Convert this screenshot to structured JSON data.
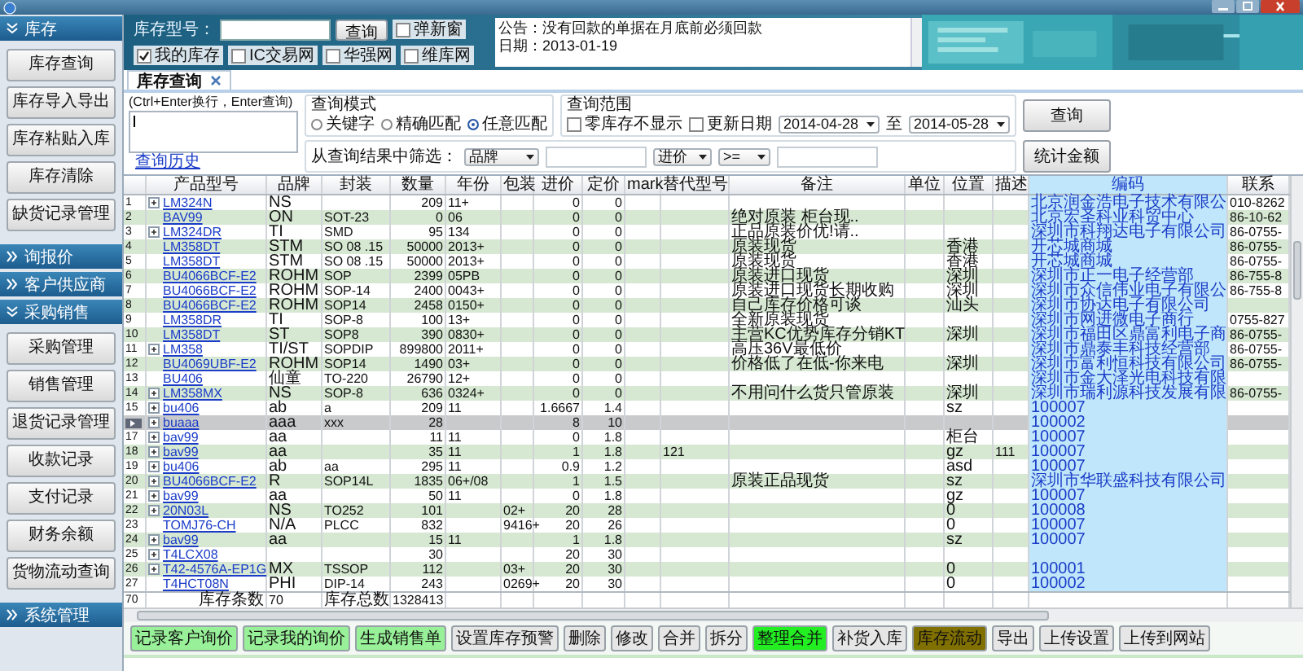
{
  "sidebar": {
    "sections": [
      {
        "title": "库存",
        "expanded": true,
        "items": [
          "库存查询",
          "库存导入导出",
          "库存粘贴入库",
          "库存清除",
          "缺货记录管理"
        ]
      },
      {
        "title": "询报价",
        "expanded": false
      },
      {
        "title": "客户供应商",
        "expanded": false
      },
      {
        "title": "采购销售",
        "expanded": true,
        "items": [
          "采购管理",
          "销售管理",
          "退货记录管理",
          "收款记录",
          "支付记录",
          "财务余额",
          "货物流动查询"
        ]
      },
      {
        "title": "系统管理",
        "expanded": false
      }
    ]
  },
  "toolbar": {
    "model_label": "库存型号：",
    "search_button": "查询",
    "new_window": {
      "label": "弹新窗",
      "checked": false
    },
    "sources": [
      {
        "label": "我的库存",
        "checked": true
      },
      {
        "label": "IC交易网",
        "checked": false
      },
      {
        "label": "华强网",
        "checked": false
      },
      {
        "label": "维库网",
        "checked": false
      }
    ]
  },
  "notice": {
    "lines": [
      "公告：没有回款的单据在月底前必须回款",
      "日期：2013-01-19"
    ]
  },
  "tabs": [
    {
      "label": "库存查询",
      "selected": true
    }
  ],
  "query": {
    "hint": "(Ctrl+Enter换行，Enter查询)",
    "history_link": "查询历史",
    "mode": {
      "title": "查询模式",
      "options": [
        {
          "label": "关键字",
          "selected": false
        },
        {
          "label": "精确匹配",
          "selected": false
        },
        {
          "label": "任意匹配",
          "selected": true
        }
      ]
    },
    "range": {
      "title": "查询范围",
      "zero_stock": {
        "label": "零库存不显示",
        "checked": false
      },
      "update_date": {
        "label": "更新日期",
        "checked": false
      },
      "from": "2014-04-28",
      "to_label": "至",
      "to": "2014-05-28"
    },
    "search_button": "查询",
    "filter": {
      "label": "从查询结果中筛选：",
      "field": "品牌",
      "price_field": "进价",
      "operator": ">="
    },
    "sum_button": "统计金额"
  },
  "table": {
    "columns": [
      "产品型号",
      "品牌",
      "封装",
      "数量",
      "年份",
      "包装",
      "进价",
      "定价",
      "mark",
      "替代型号",
      "备注",
      "单位",
      "位置",
      "描述",
      "编码",
      "联系"
    ],
    "rows": [
      {
        "no": "1",
        "expandable": true,
        "selected": false,
        "model": "LM324N",
        "brand": "NS",
        "qty": "209",
        "year": "11+",
        "cost": "0",
        "price": "0",
        "code": "北京润金浩电子技术有限公",
        "contact": "010-8262"
      },
      {
        "no": "2",
        "expandable": false,
        "selected": false,
        "model": "BAV99",
        "brand": "ON",
        "package": "SOT-23",
        "qty": "0",
        "year": "06",
        "cost": "0",
        "price": "0",
        "note": "绝对原装 柜台现..",
        "code": "北京宏圣科业科贸中心",
        "contact": "86-10-62"
      },
      {
        "no": "3",
        "expandable": true,
        "selected": false,
        "model": "LM324DR",
        "brand": "TI",
        "package": "SMD",
        "qty": "95",
        "year": "134",
        "cost": "0",
        "price": "0",
        "note": "正品原装价优!请..",
        "code": "深圳市科翔达电子有限公司",
        "contact": "86-0755-"
      },
      {
        "no": "4",
        "expandable": false,
        "selected": false,
        "model": "LM358DT",
        "brand": "STM",
        "package": "SO 08 .15",
        "qty": "50000",
        "year": "2013+",
        "cost": "0",
        "price": "0",
        "note": "原装现货",
        "location": "香港",
        "code": "开芯城商城",
        "contact": "86-0755-"
      },
      {
        "no": "5",
        "expandable": false,
        "selected": false,
        "model": "LM358DT",
        "brand": "STM",
        "package": "SO 08 .15",
        "qty": "50000",
        "year": "2013+",
        "cost": "0",
        "price": "0",
        "note": "原装现货",
        "location": "香港",
        "code": "开芯城商城",
        "contact": "86-0755-"
      },
      {
        "no": "6",
        "expandable": false,
        "selected": false,
        "model": "BU4066BCF-E2",
        "brand": "ROHM",
        "package": "SOP",
        "qty": "2399",
        "year": "05PB",
        "cost": "0",
        "price": "0",
        "note": "原装进口现货",
        "location": "深圳",
        "code": "深圳市正一电子经营部",
        "contact": "86-755-8"
      },
      {
        "no": "7",
        "expandable": false,
        "selected": false,
        "model": "BU4066BCF-E2",
        "brand": "ROHM",
        "package": "SOP-14",
        "qty": "2400",
        "year": "0043+",
        "cost": "0",
        "price": "0",
        "note": "原装进口现货长期收购",
        "location": "深圳",
        "code": "深圳市众信伟业电子有限公",
        "contact": "86-755-8"
      },
      {
        "no": "8",
        "expandable": false,
        "selected": false,
        "model": "BU4066BCF-E2",
        "brand": "ROHM",
        "package": "SOP14",
        "qty": "2458",
        "year": "0150+",
        "cost": "0",
        "price": "0",
        "note": "自己库存价格可谈",
        "location": "汕头",
        "code": "深圳市协达电子有限公司"
      },
      {
        "no": "9",
        "expandable": false,
        "selected": false,
        "model": "LM358DR",
        "brand": "TI",
        "package": "SOP-8",
        "qty": "100",
        "year": "13+",
        "cost": "0",
        "price": "0",
        "note": "全新原装现货",
        "code": "深圳市网进微电子商行",
        "contact": "0755-827"
      },
      {
        "no": "10",
        "expandable": false,
        "selected": false,
        "model": "LM358DT",
        "brand": "ST",
        "package": "SOP8",
        "qty": "390",
        "year": "0830+",
        "cost": "0",
        "price": "0",
        "note": "主营KC优势库存分销KT",
        "location": "深圳",
        "code": "深圳市福田区鼎富利电子商",
        "contact": "86-0755-"
      },
      {
        "no": "11",
        "expandable": true,
        "selected": false,
        "model": "LM358",
        "brand": "TI/ST",
        "package": "SOPDIP",
        "qty": "899800",
        "year": "2011+",
        "cost": "0",
        "price": "0",
        "note": "高压36V最低价",
        "code": "深圳市鼎泰丰科技经营部",
        "contact": "86-0755-"
      },
      {
        "no": "12",
        "expandable": false,
        "selected": false,
        "model": "BU4069UBF-E2",
        "brand": "ROHM",
        "package": "SOP14",
        "qty": "1490",
        "year": "03+",
        "cost": "0",
        "price": "0",
        "note": "价格低了在低-你来电",
        "location": "深圳",
        "code": "深圳市富利恒科技有限公司",
        "contact": "86-0755-"
      },
      {
        "no": "13",
        "expandable": false,
        "selected": false,
        "model": "BU406",
        "brand": "仙童",
        "package": "TO-220",
        "qty": "26790",
        "year": "12+",
        "cost": "0",
        "price": "0",
        "code": "深圳市金大泽光电科技有限"
      },
      {
        "no": "14",
        "expandable": true,
        "selected": false,
        "model": "LM358MX",
        "brand": "NS",
        "package": "SOP-8",
        "qty": "636",
        "year": "0324+",
        "cost": "0",
        "price": "0",
        "note": "不用问什么货只管原装",
        "location": "深圳",
        "code": "深圳市瑞利源科技发展有限",
        "contact": "86-0755-"
      },
      {
        "no": "15",
        "expandable": true,
        "selected": false,
        "model": "bu406",
        "brand": "ab",
        "package": "a",
        "qty": "209",
        "year": "11",
        "cost": "1.6667",
        "price": "1.4",
        "location": "sz",
        "code": "100007"
      },
      {
        "expandable": true,
        "selected": true,
        "model": "buaaa",
        "brand": "aaa",
        "package": "xxx",
        "qty": "28",
        "cost": "8",
        "price": "10",
        "code": "100002"
      },
      {
        "no": "17",
        "expandable": true,
        "selected": false,
        "model": "bav99",
        "brand": "aa",
        "qty": "11",
        "year": "11",
        "cost": "0",
        "price": "1.8",
        "location": "柜台",
        "code": "100007"
      },
      {
        "no": "18",
        "expandable": true,
        "selected": false,
        "model": "bav99",
        "brand": "aa",
        "qty": "35",
        "year": "11",
        "cost": "1",
        "price": "1.8",
        "alt": "121",
        "location": "gz",
        "desc": "111",
        "code": "100007"
      },
      {
        "no": "19",
        "expandable": true,
        "selected": false,
        "model": "bu406",
        "brand": "ab",
        "package": "aa",
        "qty": "295",
        "year": "11",
        "cost": "0.9",
        "price": "1.2",
        "location": "asd",
        "code": "100007"
      },
      {
        "no": "20",
        "expandable": true,
        "selected": false,
        "model": "BU4066BCF-E2",
        "brand": "R",
        "package": "SOP14L",
        "qty": "1835",
        "year": "06+/08",
        "cost": "1",
        "price": "1.5",
        "note": "原装正品现货",
        "location": "sz",
        "code": "深圳市华联盛科技有限公司"
      },
      {
        "no": "21",
        "expandable": true,
        "selected": false,
        "model": "bav99",
        "brand": "aa",
        "qty": "50",
        "year": "11",
        "cost": "0",
        "price": "1.8",
        "location": "gz",
        "code": "100007"
      },
      {
        "no": "22",
        "expandable": true,
        "selected": false,
        "model": "20N03L",
        "brand": "NS",
        "package": "TO252",
        "qty": "101",
        "pack": "02+",
        "cost": "20",
        "price": "28",
        "location": "0",
        "code": "100008"
      },
      {
        "no": "23",
        "expandable": false,
        "selected": false,
        "model": "TOMJ76-CH",
        "brand": "N/A",
        "package": "PLCC",
        "qty": "832",
        "pack": "9416+",
        "cost": "20",
        "price": "26",
        "location": "0",
        "code": "100007"
      },
      {
        "no": "24",
        "expandable": true,
        "selected": false,
        "model": "bav99",
        "brand": "aa",
        "qty": "15",
        "year": "11",
        "cost": "1",
        "price": "1.8",
        "location": "sz",
        "code": "100007"
      },
      {
        "no": "25",
        "expandable": true,
        "selected": false,
        "model": "T4LCX08",
        "qty": "30",
        "cost": "20",
        "price": "30"
      },
      {
        "no": "26",
        "expandable": true,
        "selected": false,
        "model": "T42-4576A-EP1G",
        "brand": "MX",
        "package": "TSSOP",
        "qty": "112",
        "pack": "03+",
        "cost": "20",
        "price": "30",
        "location": "0",
        "code": "100001"
      },
      {
        "no": "27",
        "expandable": false,
        "selected": false,
        "model": "T4HCT08N",
        "brand": "PHI",
        "package": "DIP-14",
        "qty": "243",
        "pack": "0269+",
        "cost": "20",
        "price": "30",
        "location": "0",
        "code": "100002"
      }
    ],
    "summary": {
      "no": "70",
      "count_label": "库存条数",
      "count": "70",
      "total_label": "库存总数",
      "total": "1328413"
    }
  },
  "buttons": [
    {
      "label": "记录客户询价",
      "color": "#98f098"
    },
    {
      "label": "记录我的询价",
      "color": "#98f098"
    },
    {
      "label": "生成销售单",
      "color": "#98f098"
    },
    {
      "label": "设置库存预警",
      "color": "#e6e6e6"
    },
    {
      "label": "删除",
      "color": "#e6e6e6"
    },
    {
      "label": "修改",
      "color": "#e6e6e6"
    },
    {
      "label": "合并",
      "color": "#e6e6e6"
    },
    {
      "label": "拆分",
      "color": "#e6e6e6"
    },
    {
      "label": "整理合并",
      "color": "#22ee22"
    },
    {
      "label": "补货入库",
      "color": "#e6e6e6"
    },
    {
      "label": "库存流动",
      "color": "#807000"
    },
    {
      "label": "导出",
      "color": "#e6e6e6"
    },
    {
      "label": "上传设置",
      "color": "#e6e6e6"
    },
    {
      "label": "上传到网站",
      "color": "#e6e6e6"
    }
  ]
}
